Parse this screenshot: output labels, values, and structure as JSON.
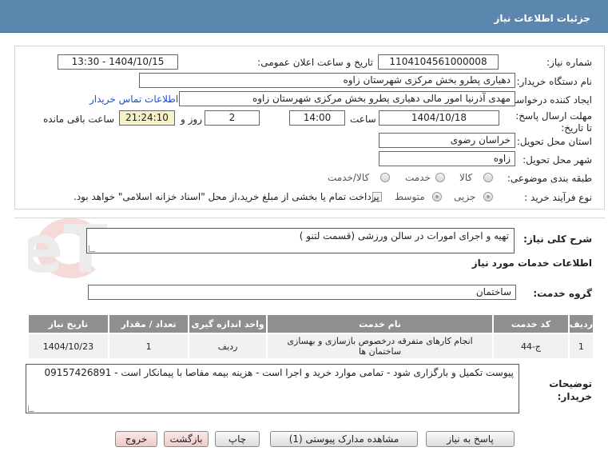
{
  "header": {
    "title": "جزئیات اطلاعات نیاز"
  },
  "form": {
    "need_number_label": "شماره نیاز:",
    "need_number": "1104104561000008",
    "announce_label": "تاریخ و ساعت اعلان عمومی:",
    "announce_value": "1404/10/15 - 13:30",
    "buyer_org_label": "نام دستگاه خریدار:",
    "buyer_org": "دهیاری پطرو بخش مرکزی شهرستان زاوه",
    "creator_label": "ایجاد کننده درخواست:",
    "creator": "مهدی آذرنیا امور مالی دهیاری پطرو بخش مرکزی شهرستان زاوه",
    "contact_link": "اطلاعات تماس خریدار",
    "deadline_label": "مهلت ارسال پاسخ: تا تاریخ:",
    "deadline_date": "1404/10/18",
    "time_label": "ساعت",
    "deadline_time": "14:00",
    "days_value": "2",
    "days_label": "روز و",
    "remaining_time": "21:24:10",
    "remaining_label": "ساعت باقی مانده",
    "province_label": "استان محل تحویل:",
    "province": "خراسان رضوی",
    "city_label": "شهر محل تحویل:",
    "city": "زاوه",
    "category_label": "طبقه بندی موضوعی:",
    "category_options": [
      "کالا",
      "خدمت",
      "کالا/خدمت"
    ],
    "process_label": "نوع فرآیند خرید :",
    "process_options": [
      "جزیی",
      "متوسط"
    ],
    "payment_note": "پرداخت تمام یا بخشی از مبلغ خرید،از محل \"اسناد خزانه اسلامی\" خواهد بود."
  },
  "summary": {
    "label": "شرح کلی نیاز:",
    "value": "تهیه و اجرای امورات در سالن ورزشی (قسمت لتنو )"
  },
  "services": {
    "title": "اطلاعات خدمات مورد نیاز",
    "group_label": "گروه خدمت:",
    "group_value": "ساختمان",
    "columns": [
      "ردیف",
      "کد خدمت",
      "نام خدمت",
      "واحد اندازه گیری",
      "تعداد / مقدار",
      "تاریخ نیاز"
    ],
    "rows": [
      [
        "1",
        "ج-44",
        "انجام کارهای متفرقه درخصوص بازسازی و بهسازی ساختمان ها",
        "ردیف",
        "1",
        "1404/10/23"
      ]
    ]
  },
  "notes": {
    "label": "توضیحات خریدار:",
    "value": "پیوست تکمیل و بارگزاری شود - تمامی موارد خرید و اجرا است - هزینه بیمه مفاصا با پیمانکار است - 09157426891"
  },
  "buttons": {
    "reply": "پاسخ به نیاز",
    "view_docs": "مشاهده مدارک پیوستی (1)",
    "print": "چاپ",
    "back": "بازگشت",
    "exit": "خروج"
  },
  "watermark": {
    "text": "AriaTender.neT"
  }
}
